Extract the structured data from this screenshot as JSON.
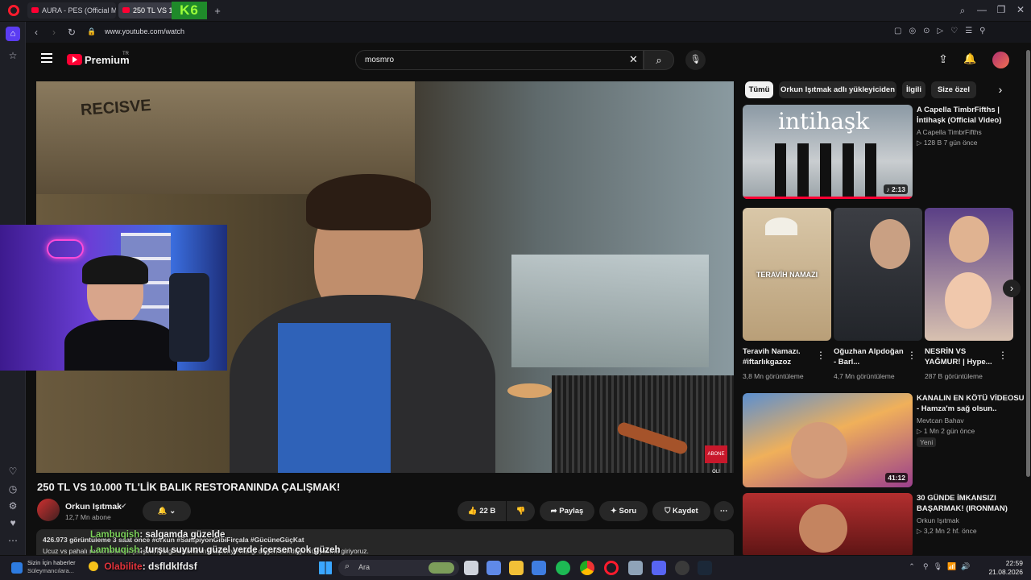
{
  "browser": {
    "tabs": [
      {
        "label": "AURA - PES (Official Musi"
      },
      {
        "label": "250 TL VS 10.000 TL'LİK"
      }
    ],
    "new_tab_symbol": "+",
    "url": "www.youtube.com/watch",
    "stream_overlay_text": "K6"
  },
  "youtube": {
    "logo_text": "Premium",
    "logo_superscript": "TR",
    "search_value": "mosmro",
    "chips": [
      "Tümü",
      "Orkun Işıtmak adlı yükleyiciden",
      "İlgili",
      "Size özel"
    ],
    "video": {
      "title": "250 TL VS 10.000 TL'LİK BALIK RESTORANINDA ÇALIŞMAK!",
      "sign_text": "RECISVE",
      "overlay_badge": "ABONE OL!",
      "channel": "Orkun Işıtmak",
      "subscribers": "12,7 Mn abone",
      "likes": "22 B",
      "share_label": "Paylaş",
      "ask_label": "Soru",
      "save_label": "Kaydet",
      "description_line1": "426.973 görüntüleme  3 saat önce  #orkun #SampiyonGibiFirçala #GücüneGüçKat",
      "description_line2": "Ucuz vs pahalı restoranlarda çalıştık; hangi restoranın müşteriye hangi değeri sunduğu dünyasına giriyoruz."
    },
    "recommendations": [
      {
        "title": "A Capella TimbrFifths | İntihaşk (Official Video)",
        "channel": "A Capella TimbrFifths",
        "meta": "▷ 128 B   7 gün önce",
        "duration": "♪ 2:13",
        "thumb_text": "intihaşk"
      },
      {
        "title": "KANALIN EN KÖTÜ VİDEOSU - Hamza'm sağ olsun..",
        "channel": "Mevtcan Bahav",
        "meta": "▷ 1 Mn   2 gün önce",
        "badge": "Yeni",
        "duration": "41:12"
      },
      {
        "title": "30 GÜNDE İMKANSIZI BAŞARMAK! (IRONMAN)",
        "channel": "Orkun Işıtmak",
        "meta": "▷ 3,2 Mn   2 hf. önce"
      }
    ],
    "shorts": [
      {
        "title": "Teravih Namazı. #iftarlıkgazoz",
        "views": "3,8 Mn görüntüleme",
        "thumb_text": "TERAVİH NAMAZI"
      },
      {
        "title": "Oğuzhan Alpdoğan - Barl...",
        "views": "4,7 Mn görüntüleme"
      },
      {
        "title": "NESRİN VS YAĞMUR! | Hype...",
        "views": "287 B görüntüleme"
      }
    ]
  },
  "chat": [
    {
      "user": "Lambuqish",
      "message": "salgamda güzelde"
    },
    {
      "user": "Lambuqish",
      "message": "turşu suyunu güzel yerde içersen çok güzeh"
    },
    {
      "user": "Olabilite",
      "message": "dsfldklfdsf"
    }
  ],
  "taskbar": {
    "news_line1": "Sizin İçin haberler",
    "news_line2": "Süleymancılara...",
    "search_label": "Ara",
    "time": "22:59",
    "date": "21.08.2026"
  },
  "colors": {
    "accent": "#ff0033",
    "chat_user": "#7bd15a",
    "chat_user2": "#e3333b"
  }
}
